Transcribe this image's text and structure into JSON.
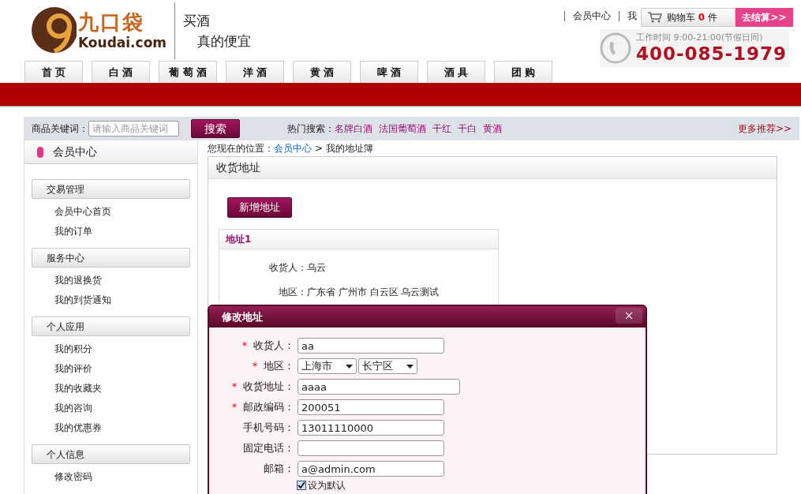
{
  "logo": {
    "name": "九口袋",
    "domain": "Koudai.com"
  },
  "slogan": [
    "买酒",
    "真的便宜"
  ],
  "top_links": [
    "会员中心",
    "我"
  ],
  "cart": {
    "label": "购物车",
    "count": "0",
    "unit": "件",
    "checkout": "去结算>>"
  },
  "hotline": {
    "hours": "工作时间 9:00-21:00(节假日同)",
    "phone": "400-085-1979"
  },
  "nav": [
    "首 页",
    "白 酒",
    "葡 萄 酒",
    "洋 酒",
    "黄 酒",
    "啤 酒",
    "酒 具",
    "团 购"
  ],
  "search": {
    "label": "商品关键词：",
    "placeholder": "请输入商品关键词",
    "button": "搜索",
    "hot_label": "热门搜索：",
    "hot": [
      "名牌白酒",
      "法国葡萄酒",
      "干红",
      "干白",
      "黄酒"
    ],
    "more": "更多推荐>>"
  },
  "sidebar": {
    "title": "会员中心",
    "groups": [
      {
        "title": "交易管理",
        "items": [
          "会员中心首页",
          "我的订单"
        ]
      },
      {
        "title": "服务中心",
        "items": [
          "我的退换货",
          "我的到货通知"
        ]
      },
      {
        "title": "个人应用",
        "items": [
          "我的积分",
          "我的评价",
          "我的收藏夹",
          "我的咨询",
          "我的优惠券"
        ]
      },
      {
        "title": "个人信息",
        "items": [
          "修改密码"
        ]
      }
    ]
  },
  "breadcrumb": {
    "label": "您现在的位置：",
    "link": "会员中心",
    "current": "> 我的地址簿"
  },
  "panel": {
    "title": "收货地址",
    "add_button": "新增地址",
    "address_card": {
      "title": "地址1",
      "fields": [
        {
          "label": "收货人：",
          "value": "乌云"
        },
        {
          "label": "地区：",
          "value": "广东省 广州市 白云区 乌云测试"
        }
      ]
    }
  },
  "dialog": {
    "title": "修改地址",
    "close": "×",
    "required_mark": "*",
    "fields": [
      {
        "kind": "text",
        "required": true,
        "label": "收货人：",
        "value": "aa"
      },
      {
        "kind": "select",
        "required": true,
        "label": "地区：",
        "options": [
          "上海市",
          "长宁区"
        ]
      },
      {
        "kind": "wide",
        "required": true,
        "label": "收货地址：",
        "value": "aaaa"
      },
      {
        "kind": "text",
        "required": true,
        "label": "邮政编码：",
        "value": "200051"
      },
      {
        "kind": "text",
        "required": false,
        "label": "手机号码：",
        "value": "13011110000"
      },
      {
        "kind": "text",
        "required": false,
        "label": "固定电话："
      },
      {
        "kind": "text",
        "required": false,
        "label": "邮箱：",
        "value": "a@admin.com"
      }
    ],
    "default_checkbox": {
      "label": "设为默认",
      "checked": true
    }
  }
}
